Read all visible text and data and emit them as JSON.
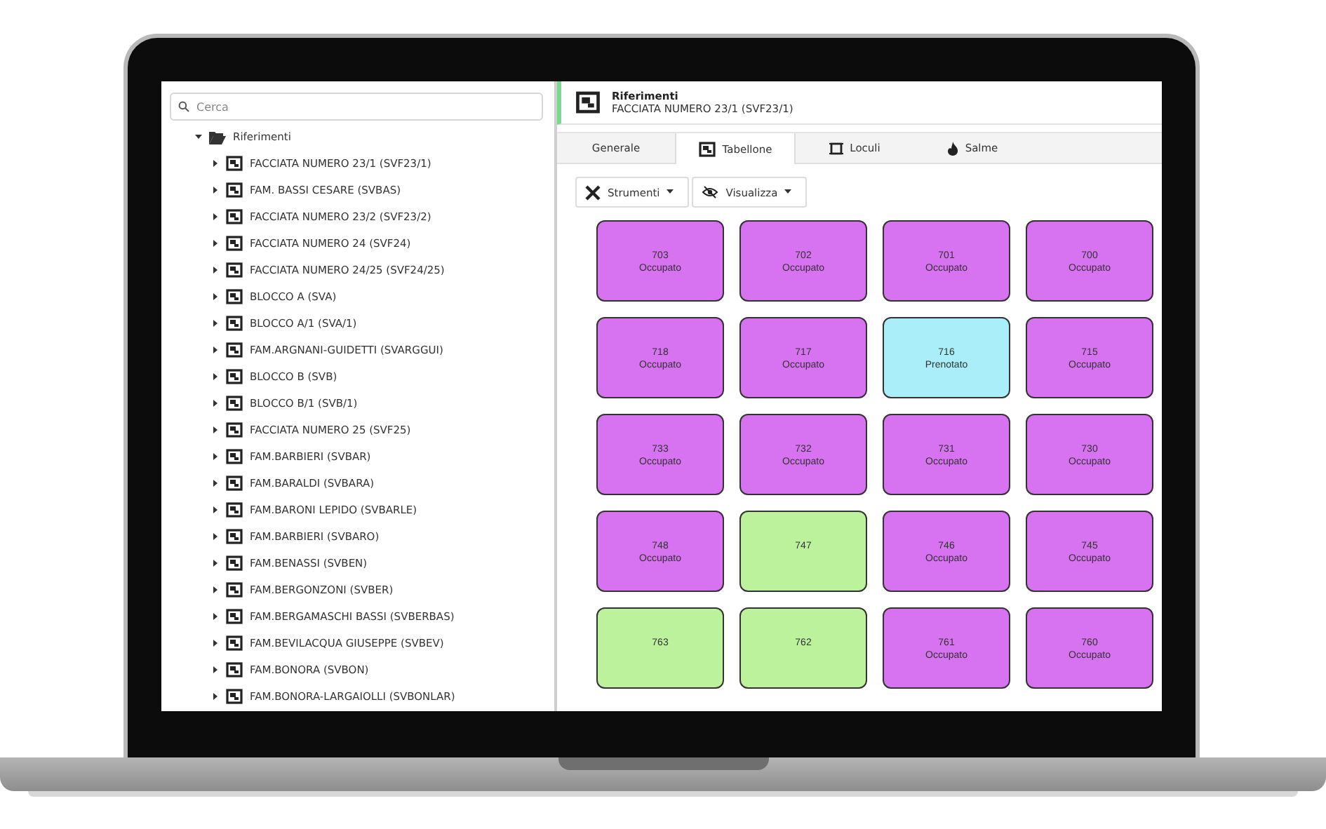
{
  "search": {
    "placeholder": "Cerca"
  },
  "tree": {
    "label": "Riferimenti",
    "expanded": true,
    "children": [
      {
        "label": "FACCIATA NUMERO 23/1 (SVF23/1)",
        "expanded": false
      },
      {
        "label": "FAM. BASSI CESARE (SVBAS)",
        "expanded": false
      },
      {
        "label": "FACCIATA NUMERO 23/2 (SVF23/2)",
        "expanded": false
      },
      {
        "label": "FACCIATA NUMERO 24 (SVF24)",
        "expanded": false
      },
      {
        "label": "FACCIATA NUMERO 24/25 (SVF24/25)",
        "expanded": false
      },
      {
        "label": "BLOCCO A (SVA)",
        "expanded": false
      },
      {
        "label": "BLOCCO A/1 (SVA/1)",
        "expanded": false
      },
      {
        "label": "FAM.ARGNANI-GUIDETTI (SVARGGUI)",
        "expanded": false
      },
      {
        "label": "BLOCCO B (SVB)",
        "expanded": false
      },
      {
        "label": "BLOCCO B/1 (SVB/1)",
        "expanded": false
      },
      {
        "label": "FACCIATA NUMERO 25 (SVF25)",
        "expanded": false
      },
      {
        "label": "FAM.BARBIERI (SVBAR)",
        "expanded": false
      },
      {
        "label": "FAM.BARALDI (SVBARA)",
        "expanded": false
      },
      {
        "label": "FAM.BARONI LEPIDO (SVBARLE)",
        "expanded": false
      },
      {
        "label": "FAM.BARBIERI (SVBARO)",
        "expanded": false
      },
      {
        "label": "FAM.BENASSI (SVBEN)",
        "expanded": false
      },
      {
        "label": "FAM.BERGONZONI (SVBER)",
        "expanded": false
      },
      {
        "label": "FAM.BERGAMASCHI BASSI (SVBERBAS)",
        "expanded": false
      },
      {
        "label": "FAM.BEVILACQUA GIUSEPPE (SVBEV)",
        "expanded": false
      },
      {
        "label": "FAM.BONORA (SVBON)",
        "expanded": false
      },
      {
        "label": "FAM.BONORA-LARGAIOLLI (SVBONLAR)",
        "expanded": false
      }
    ]
  },
  "header": {
    "title": "Riferimenti",
    "subtitle": "FACCIATA NUMERO 23/1 (SVF23/1)"
  },
  "tabs": [
    {
      "label": "Generale",
      "kind": "plain",
      "selected": false
    },
    {
      "label": "Tabellone",
      "kind": "board",
      "selected": true
    },
    {
      "label": "Loculi",
      "kind": "frame",
      "selected": false
    },
    {
      "label": "Salme",
      "kind": "flame",
      "selected": false
    }
  ],
  "toolbar": [
    {
      "label": "Strumenti",
      "kind": "tools"
    },
    {
      "label": "Visualizza",
      "kind": "view"
    }
  ],
  "tiles": [
    {
      "number": "703",
      "status": "Occupato",
      "kind": "occupied"
    },
    {
      "number": "702",
      "status": "Occupato",
      "kind": "occupied"
    },
    {
      "number": "701",
      "status": "Occupato",
      "kind": "occupied"
    },
    {
      "number": "700",
      "status": "Occupato",
      "kind": "occupied"
    },
    {
      "number": "718",
      "status": "Occupato",
      "kind": "occupied"
    },
    {
      "number": "717",
      "status": "Occupato",
      "kind": "occupied"
    },
    {
      "number": "716",
      "status": "Prenotato",
      "kind": "reserved"
    },
    {
      "number": "715",
      "status": "Occupato",
      "kind": "occupied"
    },
    {
      "number": "733",
      "status": "Occupato",
      "kind": "occupied"
    },
    {
      "number": "732",
      "status": "Occupato",
      "kind": "occupied"
    },
    {
      "number": "731",
      "status": "Occupato",
      "kind": "occupied"
    },
    {
      "number": "730",
      "status": "Occupato",
      "kind": "occupied"
    },
    {
      "number": "748",
      "status": "Occupato",
      "kind": "occupied"
    },
    {
      "number": "747",
      "kind": "free"
    },
    {
      "number": "746",
      "status": "Occupato",
      "kind": "occupied"
    },
    {
      "number": "745",
      "status": "Occupato",
      "kind": "occupied"
    },
    {
      "number": "763",
      "kind": "free"
    },
    {
      "number": "762",
      "kind": "free"
    },
    {
      "number": "761",
      "status": "Occupato",
      "kind": "occupied"
    },
    {
      "number": "760",
      "status": "Occupato",
      "kind": "occupied"
    }
  ]
}
